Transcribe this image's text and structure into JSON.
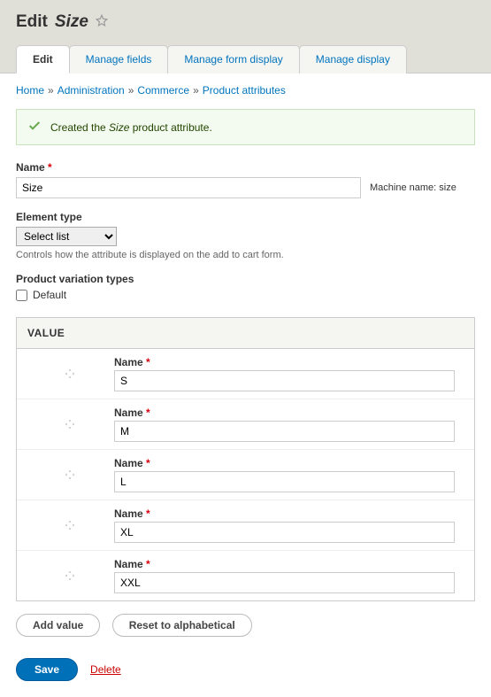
{
  "page": {
    "title_prefix": "Edit",
    "title_attr": "Size"
  },
  "tabs": [
    {
      "label": "Edit",
      "active": true
    },
    {
      "label": "Manage fields",
      "active": false
    },
    {
      "label": "Manage form display",
      "active": false
    },
    {
      "label": "Manage display",
      "active": false
    }
  ],
  "breadcrumb": {
    "home": "Home",
    "admin": "Administration",
    "commerce": "Commerce",
    "attrs": "Product attributes"
  },
  "message": {
    "prefix": "Created the ",
    "attr_name": "Size",
    "suffix": " product attribute."
  },
  "name_field": {
    "label": "Name",
    "value": "Size",
    "machine_label": "Machine name:",
    "machine_value": "size"
  },
  "element_type": {
    "label": "Element type",
    "value": "Select list",
    "description": "Controls how the attribute is displayed on the add to cart form."
  },
  "variation_types": {
    "label": "Product variation types",
    "option_label": "Default",
    "checked": false
  },
  "values": {
    "header": "VALUE",
    "row_label": "Name",
    "items": [
      "S",
      "M",
      "L",
      "XL",
      "XXL"
    ]
  },
  "buttons": {
    "add_value": "Add value",
    "reset": "Reset to alphabetical",
    "save": "Save",
    "delete": "Delete"
  }
}
